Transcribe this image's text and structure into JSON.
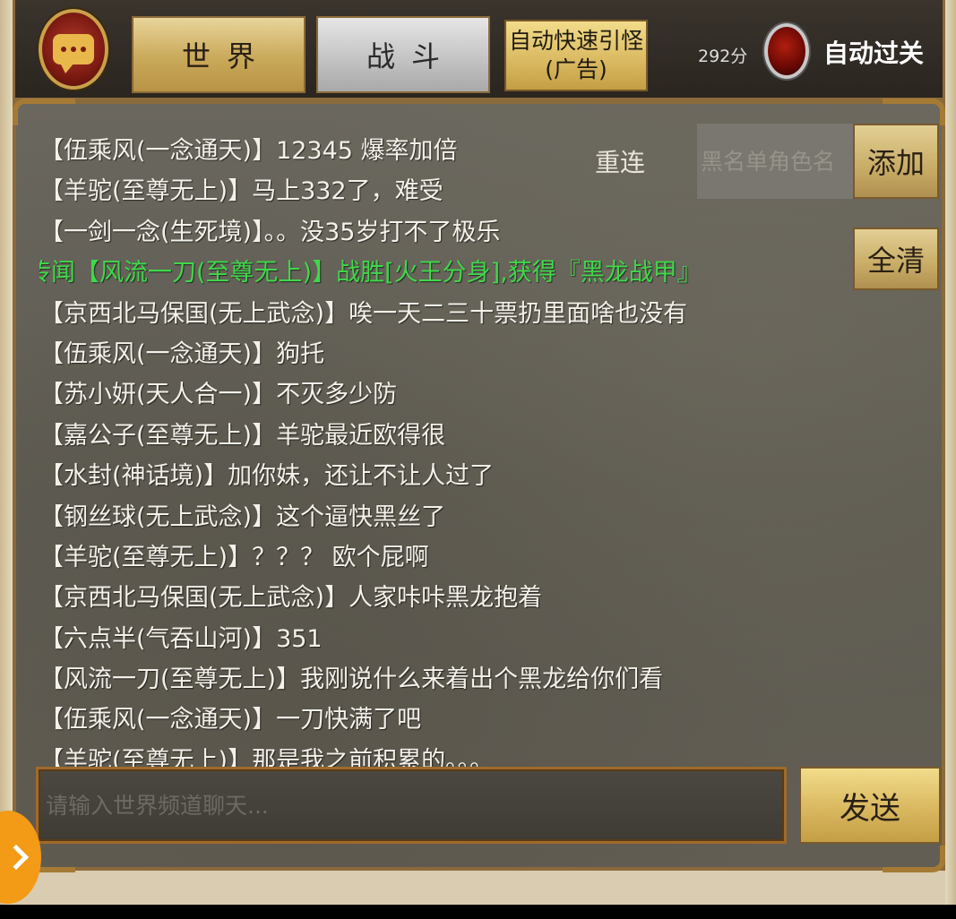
{
  "tabs": {
    "world": "世界",
    "battle": "战斗"
  },
  "auto_lure": {
    "line1": "自动快速引怪",
    "line2": "(广告)"
  },
  "score": "292分",
  "auto_pass_label": "自动过关",
  "reconnect_label": "重连",
  "blacklist": {
    "placeholder": "黑名单角色名",
    "add_label": "添加",
    "clear_label": "全清"
  },
  "messages": [
    {
      "text": "【伍乘风(一念通天)】12345  爆率加倍",
      "type": "player"
    },
    {
      "text": "【羊驼(至尊无上)】马上332了，难受",
      "type": "player"
    },
    {
      "text": "【一剑一念(生死境)】。。没35岁打不了极乐",
      "type": "player"
    },
    {
      "text": "传闻【风流一刀(至尊无上)】战胜[火王分身],获得『黑龙战甲』",
      "type": "system"
    },
    {
      "text": "【京西北马保国(无上武念)】唉一天二三十票扔里面啥也没有",
      "type": "player"
    },
    {
      "text": "【伍乘风(一念通天)】狗托",
      "type": "player"
    },
    {
      "text": "【苏小妍(天人合一)】不灭多少防",
      "type": "player"
    },
    {
      "text": "【嘉公子(至尊无上)】羊驼最近欧得很",
      "type": "player"
    },
    {
      "text": "【水封(神话境)】加你妹，还让不让人过了",
      "type": "player"
    },
    {
      "text": "【钢丝球(无上武念)】这个逼快黑丝了",
      "type": "player"
    },
    {
      "text": "【羊驼(至尊无上)】？？？ 欧个屁啊",
      "type": "player"
    },
    {
      "text": "【京西北马保国(无上武念)】人家咔咔黑龙抱着",
      "type": "player"
    },
    {
      "text": "【六点半(气吞山河)】351",
      "type": "player"
    },
    {
      "text": "【风流一刀(至尊无上)】我刚说什么来着出个黑龙给你们看",
      "type": "player"
    },
    {
      "text": "【伍乘风(一念通天)】一刀快满了吧",
      "type": "player"
    },
    {
      "text": "【羊驼(至尊无上)】那是我之前积累的。。。",
      "type": "player"
    }
  ],
  "chat_input": {
    "placeholder": "请输入世界频道聊天...",
    "send_label": "发送"
  },
  "icons": {
    "chat": "chat-bubble-icon",
    "record": "red-record-button-icon",
    "side_handle": "chevron-right-icon"
  },
  "colors": {
    "system_message": "#3fd84a",
    "player_message": "#f4f1ea",
    "gold_button": "#d9b860",
    "frame_gold": "#8a6a3a"
  }
}
